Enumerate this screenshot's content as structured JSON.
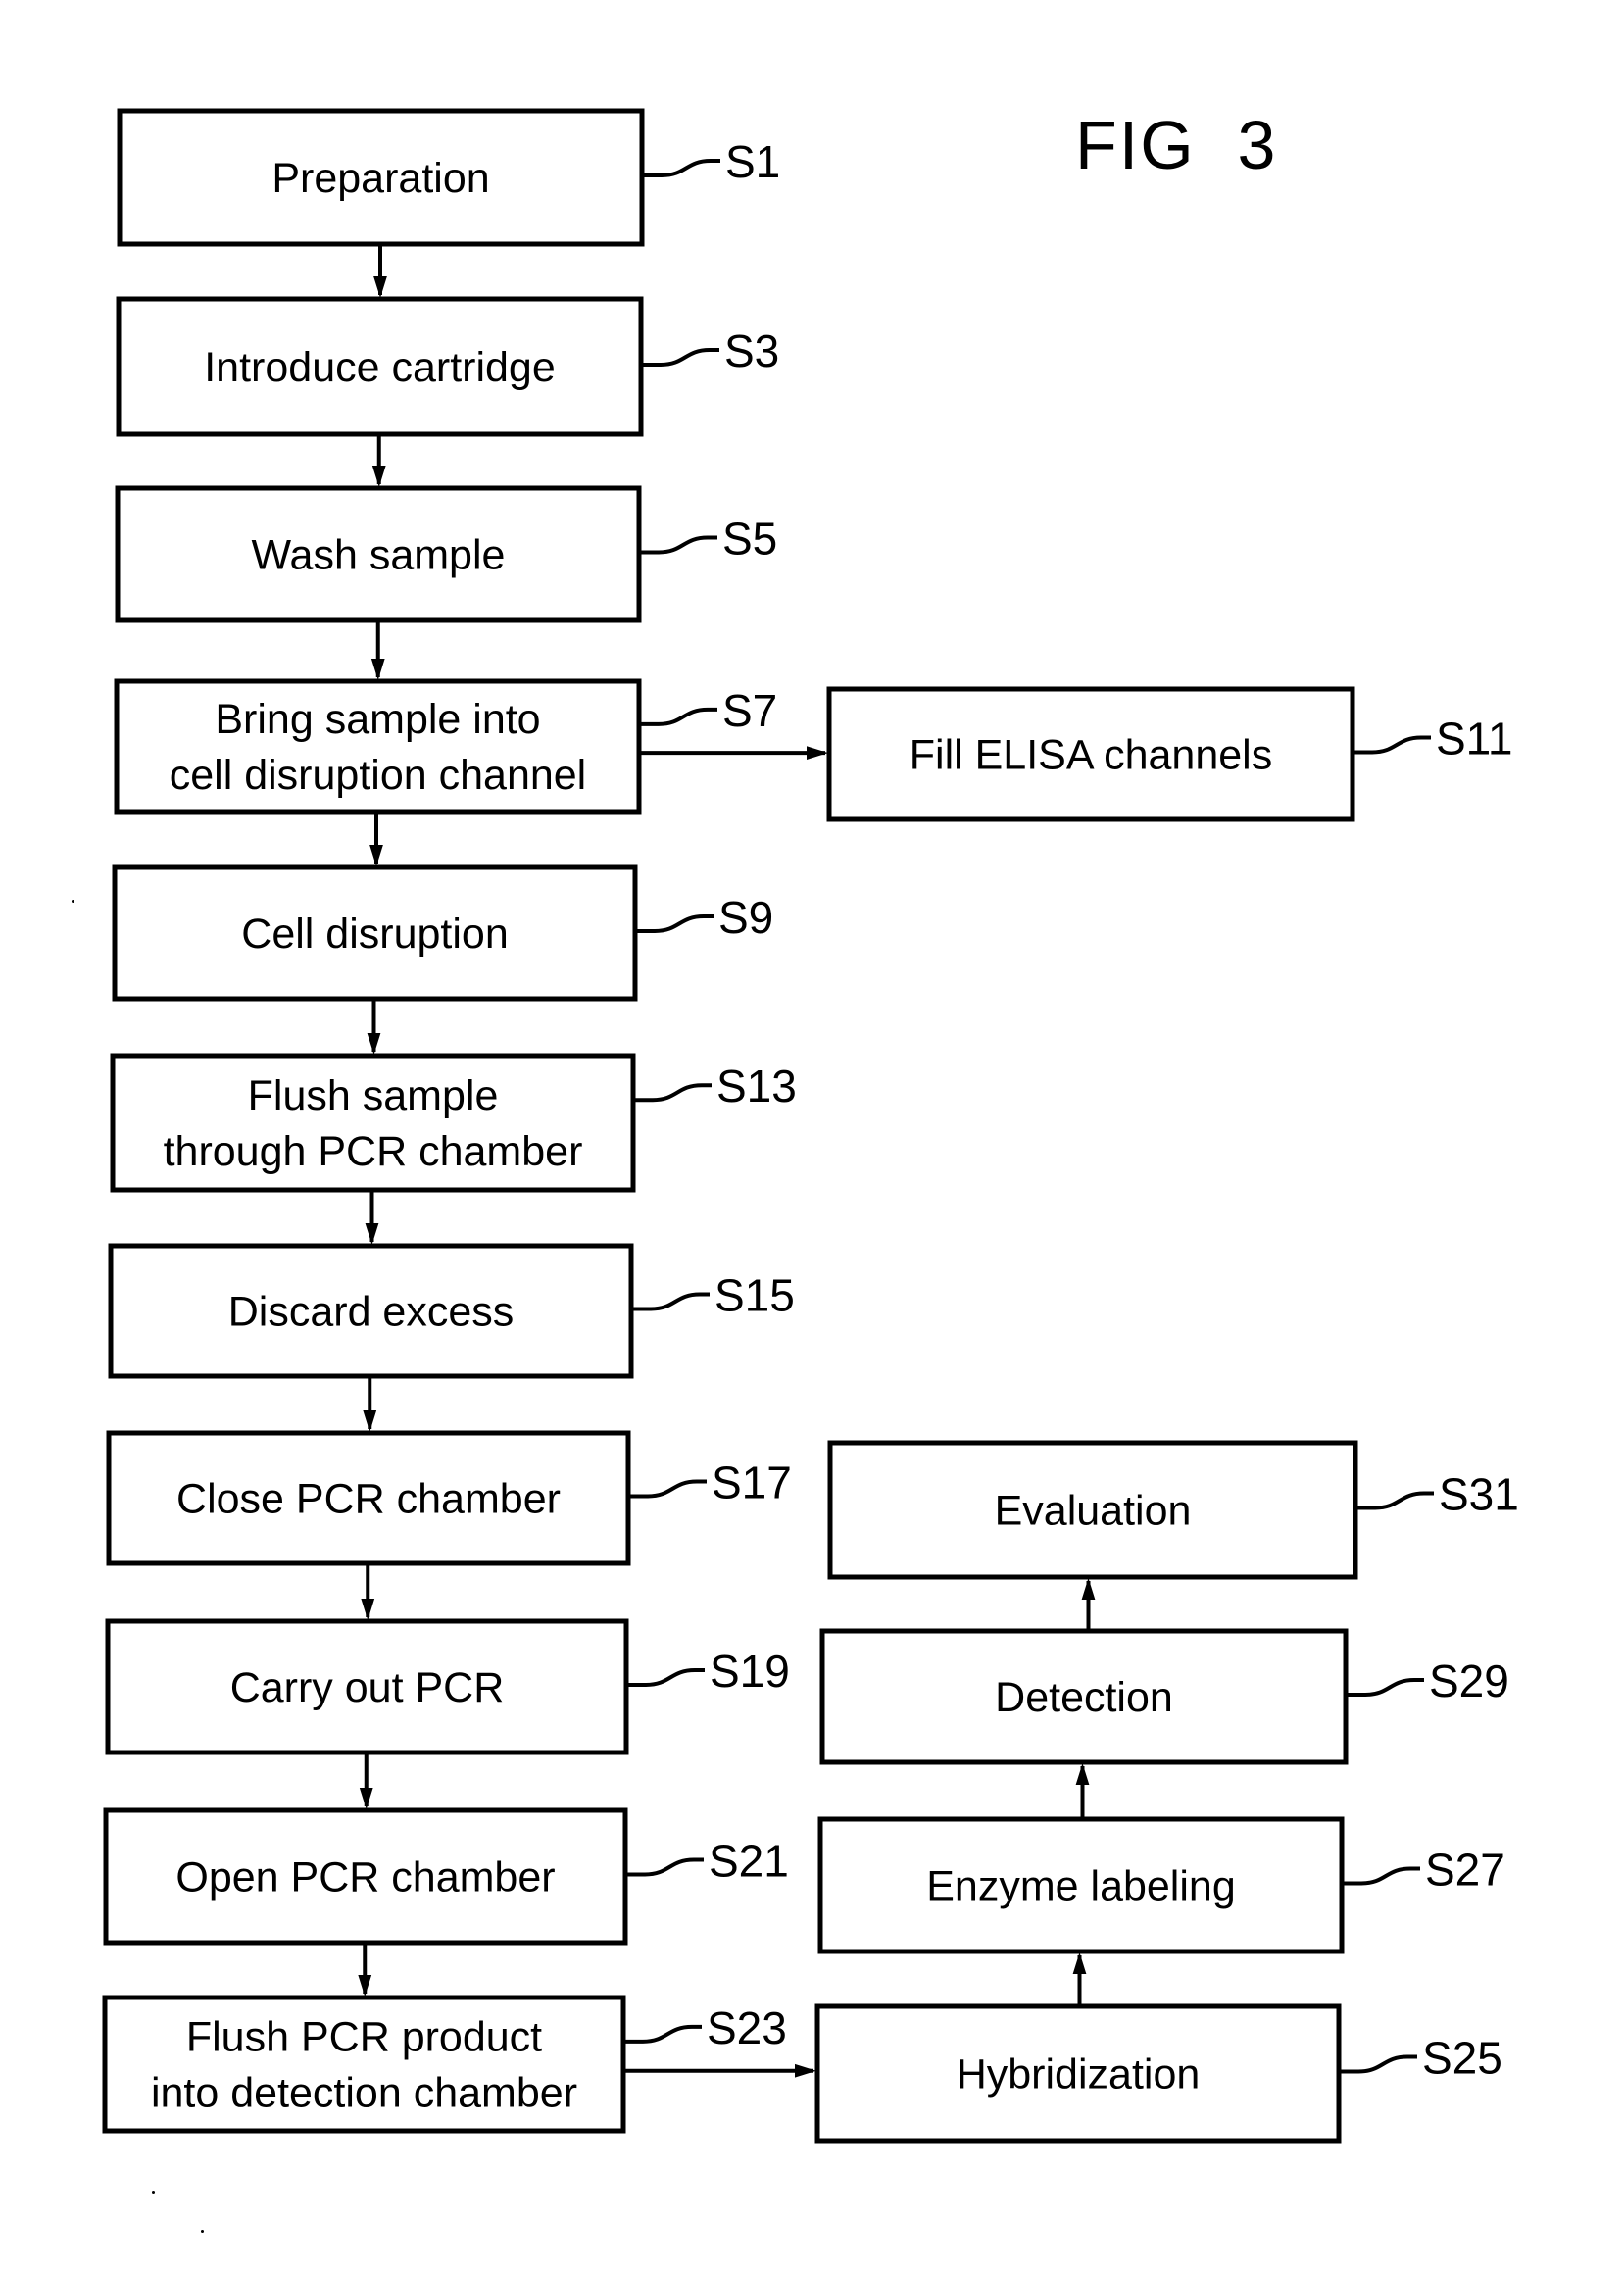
{
  "figure": {
    "title": "FIG  3"
  },
  "steps": [
    {
      "id": "S1",
      "label": "S1",
      "lines": [
        "Preparation"
      ]
    },
    {
      "id": "S3",
      "label": "S3",
      "lines": [
        "Introduce cartridge"
      ]
    },
    {
      "id": "S5",
      "label": "S5",
      "lines": [
        "Wash sample"
      ]
    },
    {
      "id": "S7",
      "label": "S7",
      "lines": [
        "Bring sample into",
        "cell disruption channel"
      ]
    },
    {
      "id": "S9",
      "label": "S9",
      "lines": [
        "Cell disruption"
      ]
    },
    {
      "id": "S11",
      "label": "S11",
      "lines": [
        "Fill ELISA channels"
      ]
    },
    {
      "id": "S13",
      "label": "S13",
      "lines": [
        "Flush sample",
        "through PCR chamber"
      ]
    },
    {
      "id": "S15",
      "label": "S15",
      "lines": [
        "Discard excess"
      ]
    },
    {
      "id": "S17",
      "label": "S17",
      "lines": [
        "Close PCR chamber"
      ]
    },
    {
      "id": "S19",
      "label": "S19",
      "lines": [
        "Carry out PCR"
      ]
    },
    {
      "id": "S21",
      "label": "S21",
      "lines": [
        "Open PCR chamber"
      ]
    },
    {
      "id": "S23",
      "label": "S23",
      "lines": [
        "Flush PCR product",
        "into detection chamber"
      ]
    },
    {
      "id": "S25",
      "label": "S25",
      "lines": [
        "Hybridization"
      ]
    },
    {
      "id": "S27",
      "label": "S27",
      "lines": [
        "Enzyme labeling"
      ]
    },
    {
      "id": "S29",
      "label": "S29",
      "lines": [
        "Detection"
      ]
    },
    {
      "id": "S31",
      "label": "S31",
      "lines": [
        "Evaluation"
      ]
    }
  ],
  "connections": [
    {
      "from": "S1",
      "to": "S3"
    },
    {
      "from": "S3",
      "to": "S5"
    },
    {
      "from": "S5",
      "to": "S7"
    },
    {
      "from": "S7",
      "to": "S9"
    },
    {
      "from": "S7",
      "to": "S11"
    },
    {
      "from": "S9",
      "to": "S13"
    },
    {
      "from": "S13",
      "to": "S15"
    },
    {
      "from": "S15",
      "to": "S17"
    },
    {
      "from": "S17",
      "to": "S19"
    },
    {
      "from": "S19",
      "to": "S21"
    },
    {
      "from": "S21",
      "to": "S23"
    },
    {
      "from": "S23",
      "to": "S25"
    },
    {
      "from": "S25",
      "to": "S27"
    },
    {
      "from": "S27",
      "to": "S29"
    },
    {
      "from": "S29",
      "to": "S31"
    }
  ]
}
